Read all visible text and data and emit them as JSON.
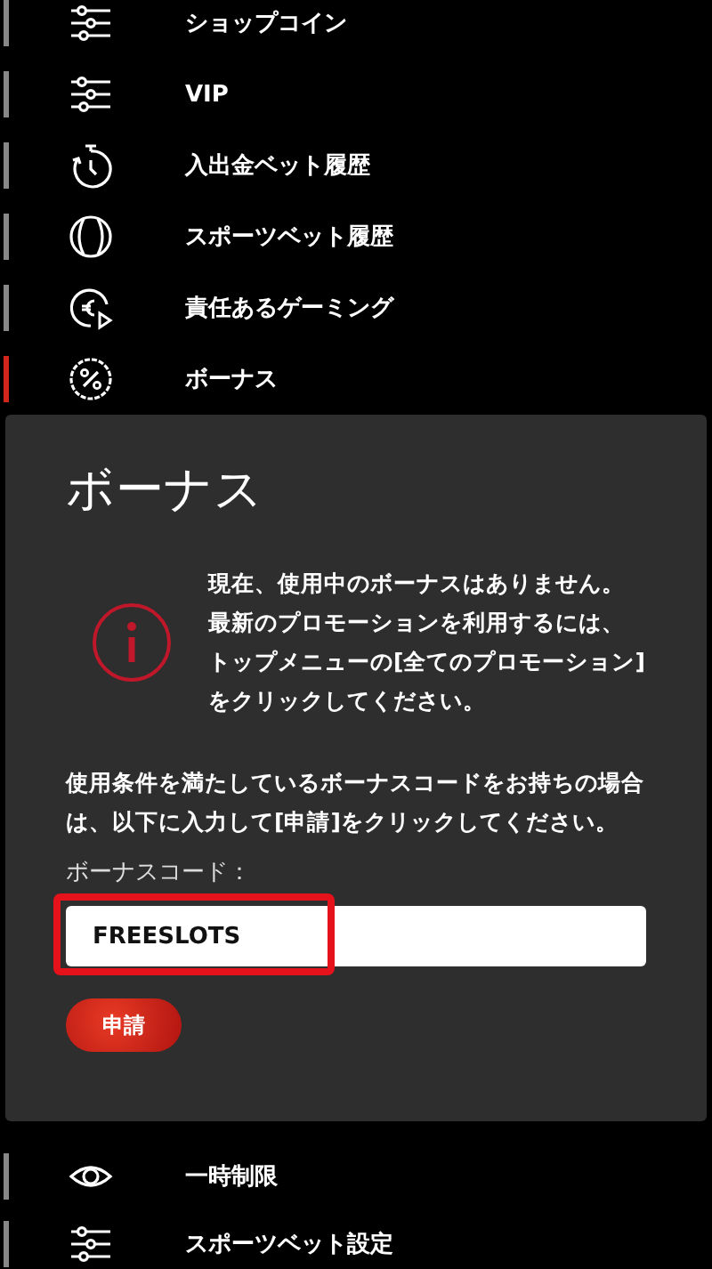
{
  "menu_top": [
    {
      "label": "ショップコイン",
      "kind": "sliders",
      "selected": false
    },
    {
      "label": "VIP",
      "kind": "sliders",
      "selected": false
    },
    {
      "label": "入出金ベット履歴",
      "kind": "timer",
      "selected": false
    },
    {
      "label": "スポーツベット履歴",
      "kind": "ball",
      "selected": false
    },
    {
      "label": "責任あるゲーミング",
      "kind": "euro",
      "selected": false
    },
    {
      "label": "ボーナス",
      "kind": "percent",
      "selected": true
    }
  ],
  "bonus_panel": {
    "title": "ボーナス",
    "notice": "現在、使用中のボーナスはありません。最新のプロモーションを利用するには、トップメニューの[全てのプロモーション]をクリックしてください。",
    "instructions": "使用条件を満たしているボーナスコードをお持ちの場合は、以下に入力して[申請]をクリックしてください。",
    "code_label": "ボーナスコード：",
    "code_field": {
      "value": "FREESLOTS",
      "highlighted": true
    },
    "apply_button": "申請"
  },
  "menu_bottom": [
    {
      "label": "一時制限",
      "kind": "eye",
      "selected": false
    },
    {
      "label": "スポーツベット設定",
      "kind": "sliders",
      "selected": false
    }
  ]
}
